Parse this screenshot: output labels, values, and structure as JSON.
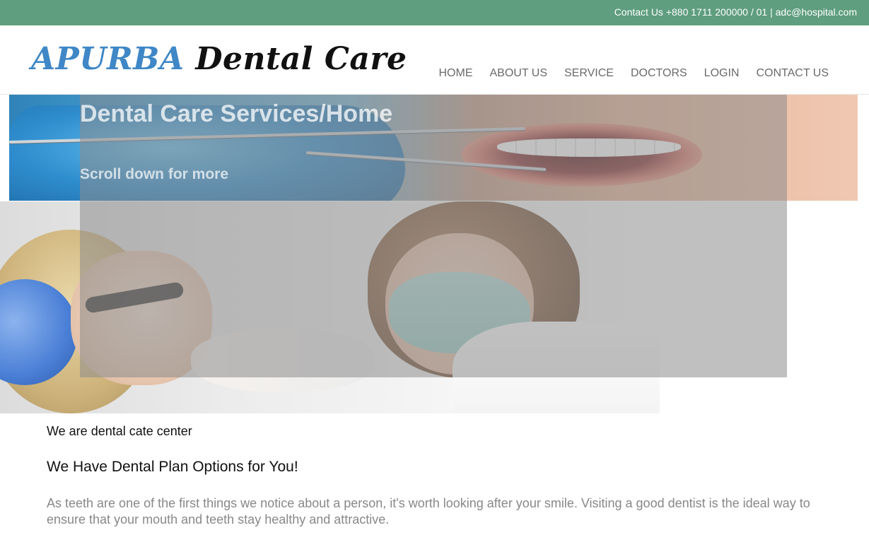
{
  "topbar": {
    "contact_text": "Contact Us +880 1711 200000 / 01 | adc@hospital.com",
    "background_color": "#5f9e7e"
  },
  "header": {
    "logo_first": "APURBA",
    "logo_second": "Dental Care",
    "logo_first_color": "#3f87c6",
    "logo_second_color": "#111111"
  },
  "nav": {
    "items": [
      {
        "label": "HOME"
      },
      {
        "label": "ABOUT US"
      },
      {
        "label": "SERVICE"
      },
      {
        "label": "DOCTORS"
      },
      {
        "label": "LOGIN"
      },
      {
        "label": "CONTACT US"
      }
    ]
  },
  "hero": {
    "title": "Dental Care Services/Home",
    "subtitle": "Scroll down for more"
  },
  "content": {
    "tagline": "We are dental cate center",
    "heading": "We Have Dental Plan Options for You!",
    "body": "As teeth are one of the first things we notice about a person, it's worth looking after your smile. Visiting a good dentist is the ideal way to ensure that your mouth and teeth stay healthy and attractive."
  }
}
